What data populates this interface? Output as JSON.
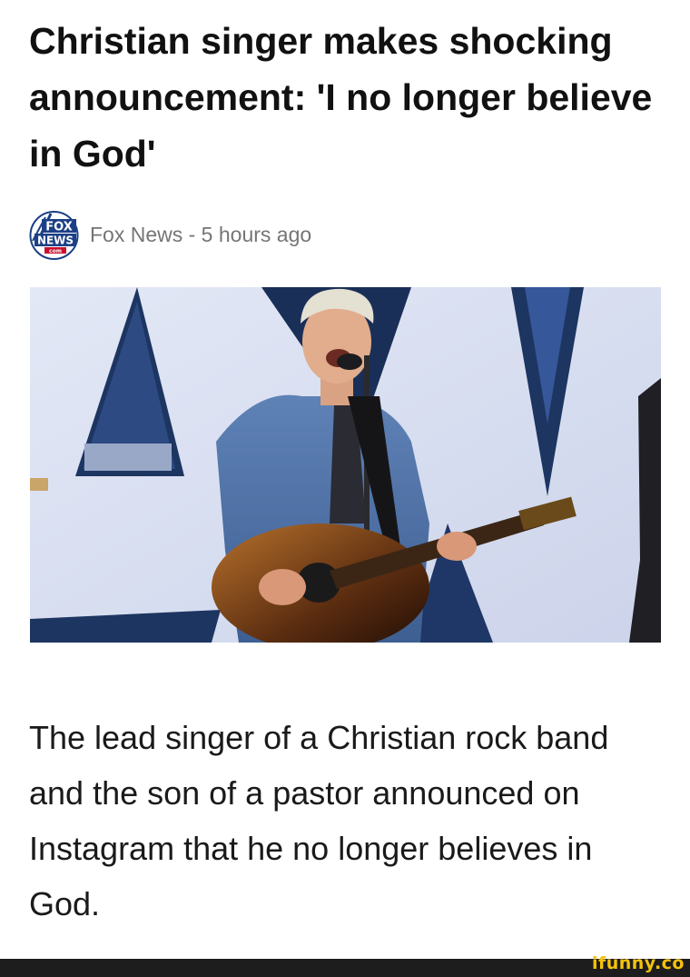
{
  "article": {
    "headline": "Christian singer makes shocking announcement: 'I no longer believe in God'",
    "source": "Fox News - 5 hours ago",
    "body": "The lead singer of a Christian rock band and the son of a pastor announced on Instagram that he no longer believes in God."
  },
  "logo": {
    "line1": "FOX",
    "line2": "NEWS",
    "line3": "com"
  },
  "watermark": {
    "text": "ifunny.co"
  },
  "colors": {
    "background": "#ffffff",
    "headline": "#111111",
    "meta": "#757575",
    "fox_blue": "#1c3f86",
    "fox_red": "#c8102e",
    "watermark_yellow": "#f4c20d",
    "footer": "#1d1d1d"
  }
}
